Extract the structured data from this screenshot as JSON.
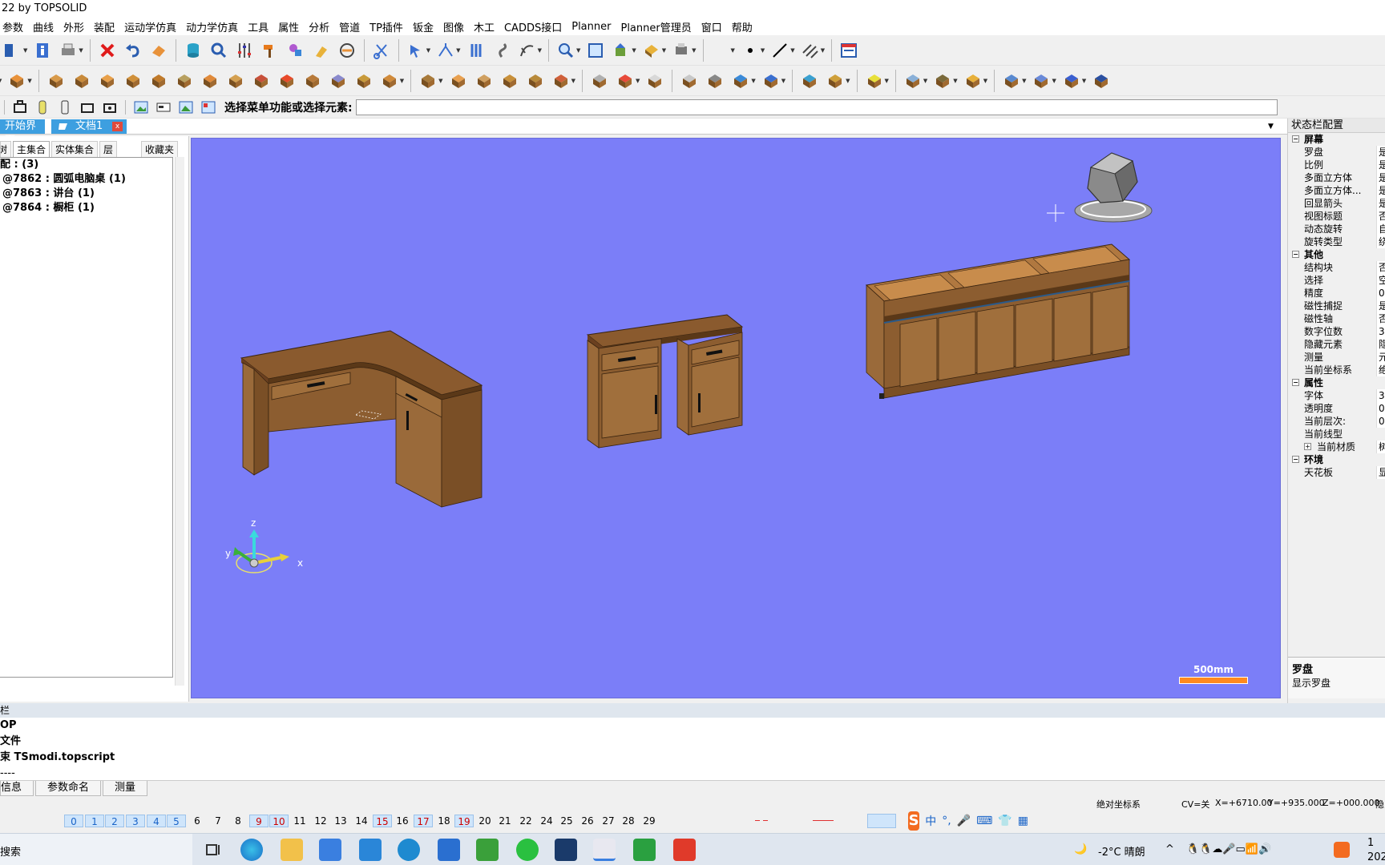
{
  "window": {
    "title": "22 by TOPSOLID"
  },
  "menu": [
    "参数",
    "曲线",
    "外形",
    "装配",
    "运动学仿真",
    "动力学仿真",
    "工具",
    "属性",
    "分析",
    "管道",
    "TP插件",
    "钣金",
    "图像",
    "木工",
    "CADDS接口",
    "Planner",
    "Planner管理员",
    "窗口",
    "帮助"
  ],
  "command_bar": {
    "prompt": "选择菜单功能或选择元素:",
    "value": ""
  },
  "doc_tabs": {
    "start": "开始界面",
    "doc": "文档1",
    "close": "x"
  },
  "left_panel": {
    "tabs": [
      "树",
      "主集合",
      "实体集合",
      "层",
      "收藏夹"
    ],
    "active_tab": "主集合",
    "tree": {
      "root": "配 : (3)",
      "items": [
        "@7862 : 圆弧电脑桌 (1)",
        "@7863 : 讲台 (1)",
        "@7864 : 橱柜 (1)"
      ]
    }
  },
  "viewport": {
    "background": "#7b7ef8",
    "scale_label": "500mm",
    "axes": {
      "z": "z",
      "y": "y",
      "x": "x"
    }
  },
  "right_panel": {
    "title": "状态栏配置",
    "rows": [
      {
        "type": "cat",
        "k": "屏幕"
      },
      {
        "type": "row",
        "k": "罗盘",
        "v": "是"
      },
      {
        "type": "row",
        "k": "比例",
        "v": "是"
      },
      {
        "type": "row",
        "k": "多面立方体",
        "v": "是"
      },
      {
        "type": "row",
        "k": "多面立方体...",
        "v": "是"
      },
      {
        "type": "row",
        "k": "回显箭头",
        "v": "是"
      },
      {
        "type": "row",
        "k": "视图标题",
        "v": "否"
      },
      {
        "type": "row",
        "k": "动态旋转",
        "v": "自"
      },
      {
        "type": "row",
        "k": "旋转类型",
        "v": "绕"
      },
      {
        "type": "cat",
        "k": "其他"
      },
      {
        "type": "row",
        "k": "结构块",
        "v": "否"
      },
      {
        "type": "row",
        "k": "选择",
        "v": "空"
      },
      {
        "type": "row",
        "k": "精度",
        "v": "0."
      },
      {
        "type": "row",
        "k": "磁性捕捉",
        "v": "是"
      },
      {
        "type": "row",
        "k": "磁性轴",
        "v": "否"
      },
      {
        "type": "row",
        "k": "数字位数",
        "v": "3"
      },
      {
        "type": "row",
        "k": "隐藏元素",
        "v": "隐"
      },
      {
        "type": "row",
        "k": "测量",
        "v": "元"
      },
      {
        "type": "row",
        "k": "当前坐标系",
        "v": "绝"
      },
      {
        "type": "cat",
        "k": "属性"
      },
      {
        "type": "row",
        "k": "字体",
        "v": "3."
      },
      {
        "type": "row",
        "k": "透明度",
        "v": "0"
      },
      {
        "type": "row",
        "k": "当前层次:",
        "v": "0"
      },
      {
        "type": "row",
        "k": "当前线型",
        "v": ""
      },
      {
        "type": "sub",
        "k": "当前材质",
        "v": "树"
      },
      {
        "type": "cat",
        "k": "环境"
      },
      {
        "type": "row",
        "k": "天花板",
        "v": "显"
      }
    ],
    "desc_title": "罗盘",
    "desc_text": "显示罗盘"
  },
  "output": {
    "header": "栏",
    "lines": [
      "OP",
      "文件",
      "束 TSmodi.topscript",
      "----"
    ],
    "tabs": [
      "信息",
      "参数命名",
      "测量"
    ]
  },
  "status": {
    "coord_system": "绝对坐标系",
    "cv": "CV=关",
    "x": "X=+6710.00",
    "y": "Y=+935.000",
    "z": "Z=+000.000",
    "tail": "隐"
  },
  "layers": {
    "items": [
      "0",
      "1",
      "2",
      "3",
      "4",
      "5",
      "6",
      "7",
      "8",
      "9",
      "10",
      "11",
      "12",
      "13",
      "14",
      "15",
      "16",
      "17",
      "18",
      "19",
      "20",
      "21",
      "22",
      "24",
      "25",
      "26",
      "27",
      "28",
      "29"
    ],
    "active": [
      "0",
      "1",
      "2",
      "3",
      "4",
      "5",
      "9",
      "10",
      "15",
      "17",
      "19"
    ],
    "red": [
      "9",
      "10",
      "15",
      "17",
      "19"
    ]
  },
  "ime": {
    "logo": "S",
    "label": "中"
  },
  "taskbar": {
    "search": "搜索",
    "weather": "-2°C 晴朗",
    "time": "1",
    "date": "202"
  }
}
